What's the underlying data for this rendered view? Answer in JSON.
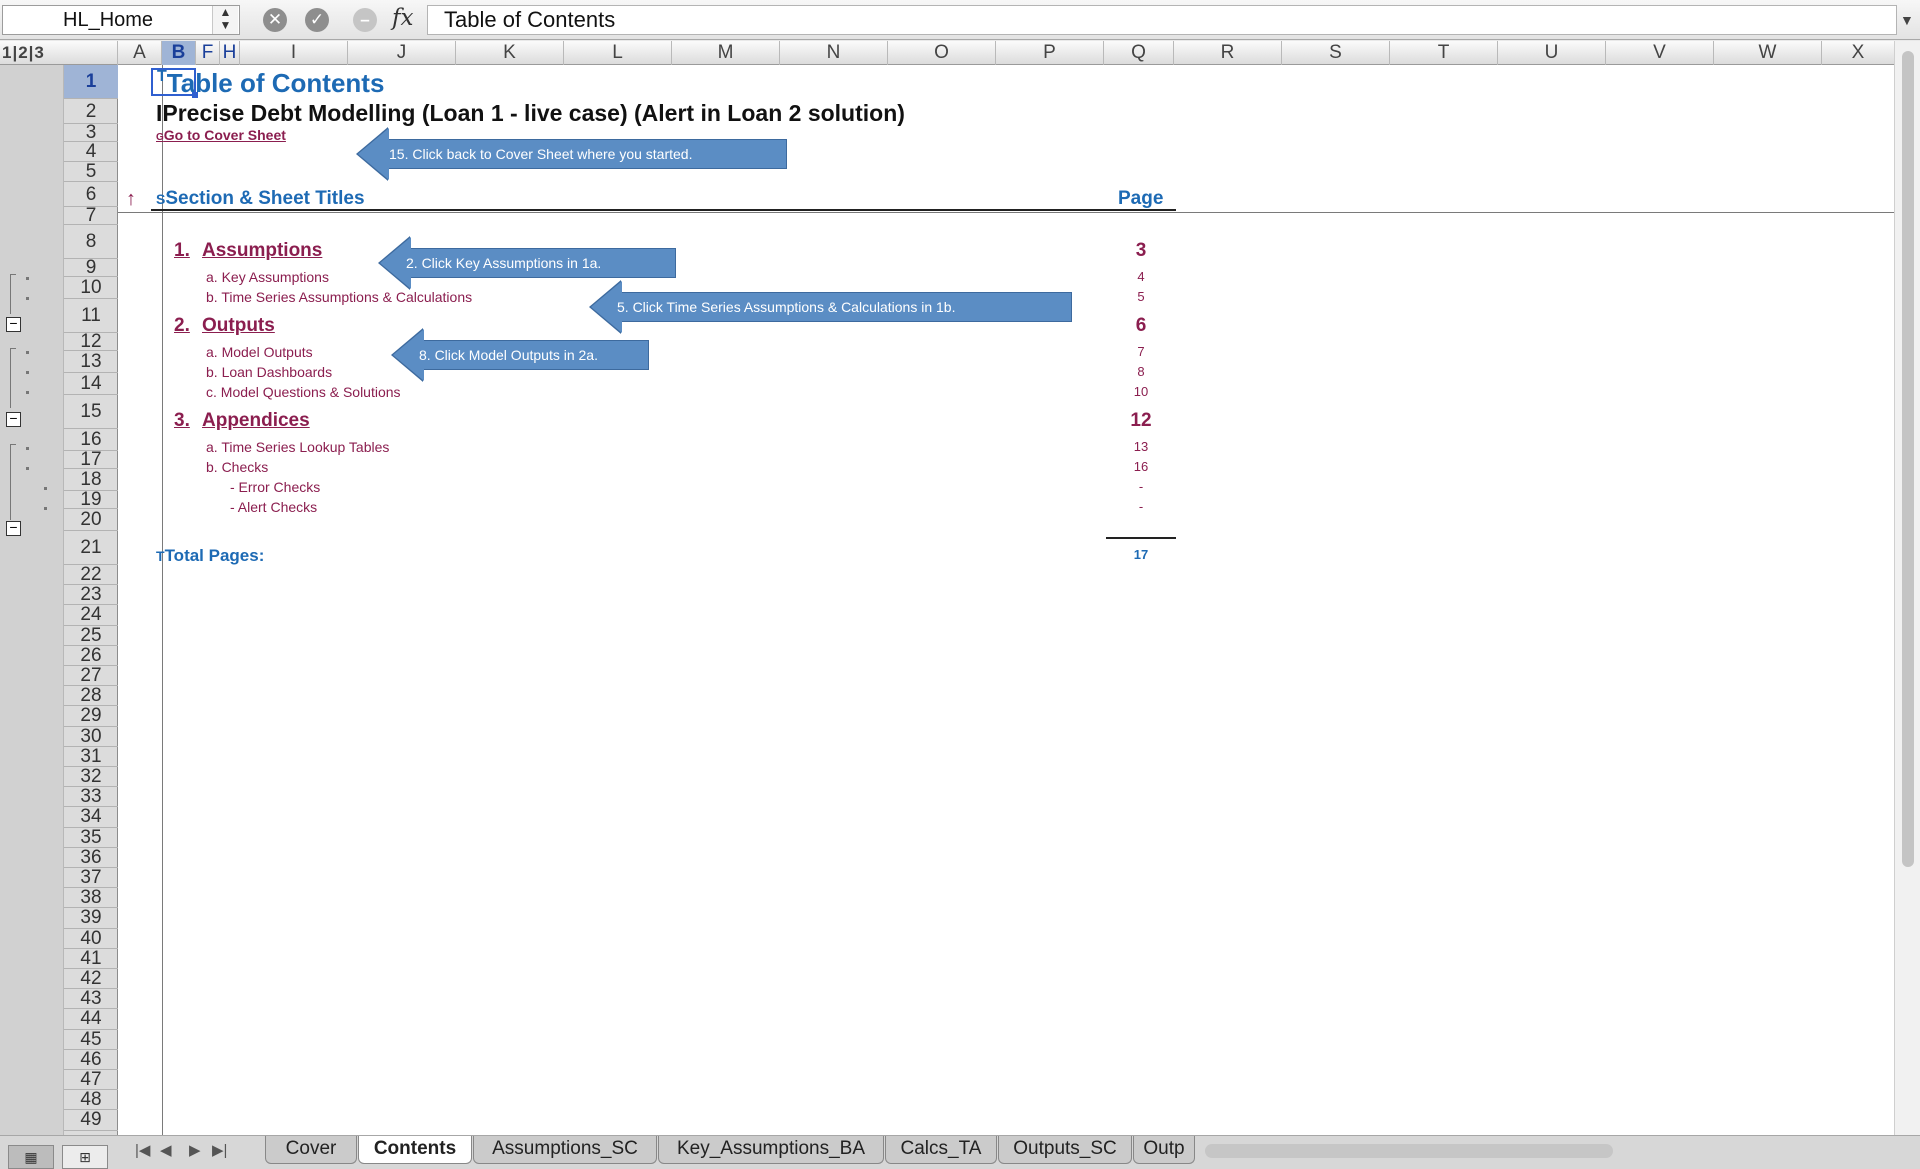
{
  "formula_bar": {
    "name_box": "HL_Home",
    "formula": "Table of Contents"
  },
  "outline_levels": "1|2|3",
  "columns": [
    "A",
    "B",
    "F",
    "H",
    "I",
    "J",
    "K",
    "L",
    "M",
    "N",
    "O",
    "P",
    "Q",
    "R",
    "S",
    "T",
    "U",
    "V",
    "W",
    "X"
  ],
  "rows": [
    "1",
    "2",
    "3",
    "4",
    "5",
    "6",
    "7",
    "8",
    "9",
    "10",
    "11",
    "12",
    "13",
    "14",
    "15",
    "16",
    "17",
    "18",
    "19",
    "20",
    "21",
    "22",
    "23",
    "24",
    "25",
    "26",
    "27",
    "28",
    "29",
    "30",
    "31",
    "32",
    "33",
    "34",
    "35",
    "36",
    "37",
    "38",
    "39",
    "40",
    "41",
    "42",
    "43",
    "44",
    "45",
    "46",
    "47",
    "48",
    "49"
  ],
  "content": {
    "title": "Table of Contents",
    "title_prefix": "T",
    "subtitle": "Precise Debt Modelling (Loan 1 - live case) (Alert in Loan 2 solution)",
    "subtitle_prefix": "I",
    "cover_link": "Go to Cover Sheet",
    "cover_prefix": "G",
    "up_arrow": "↑",
    "header_prefix": "S",
    "header_left": "Section & Sheet Titles",
    "header_right": "Page",
    "sections": [
      {
        "num": "1.",
        "title": "Assumptions",
        "page": "3",
        "items": [
          {
            "label": "a.  Key Assumptions",
            "page": "4"
          },
          {
            "label": "b.  Time Series Assumptions & Calculations",
            "page": "5"
          }
        ]
      },
      {
        "num": "2.",
        "title": "Outputs",
        "page": "6",
        "items": [
          {
            "label": "a.  Model Outputs",
            "page": "7"
          },
          {
            "label": "b.  Loan Dashboards",
            "page": "8"
          },
          {
            "label": "c.  Model Questions & Solutions",
            "page": "10"
          }
        ]
      },
      {
        "num": "3.",
        "title": "Appendices",
        "page": "12",
        "items": [
          {
            "label": "a.  Time Series Lookup Tables",
            "page": "13"
          },
          {
            "label": "b.  Checks",
            "page": "16"
          },
          {
            "label": "-  Error Checks",
            "page": "-"
          },
          {
            "label": "-  Alert Checks",
            "page": "-"
          }
        ]
      }
    ],
    "total_prefix": "T",
    "total_label": "Total Pages:",
    "total_value": "17"
  },
  "callouts": [
    "15. Click back to Cover Sheet where you started.",
    "2. Click Key Assumptions  in 1a.",
    "5. Click Time Series Assumptions & Calculations in 1b.",
    "8. Click Model Outputs in 2a."
  ],
  "sheet_tabs": [
    "Cover",
    "Contents",
    "Assumptions_SC",
    "Key_Assumptions_BA",
    "Calcs_TA",
    "Outputs_SC",
    "Outp"
  ],
  "active_tab": "Contents",
  "icons": {
    "cancel": "cancel-icon",
    "confirm": "confirm-icon",
    "function": "fx-icon"
  }
}
